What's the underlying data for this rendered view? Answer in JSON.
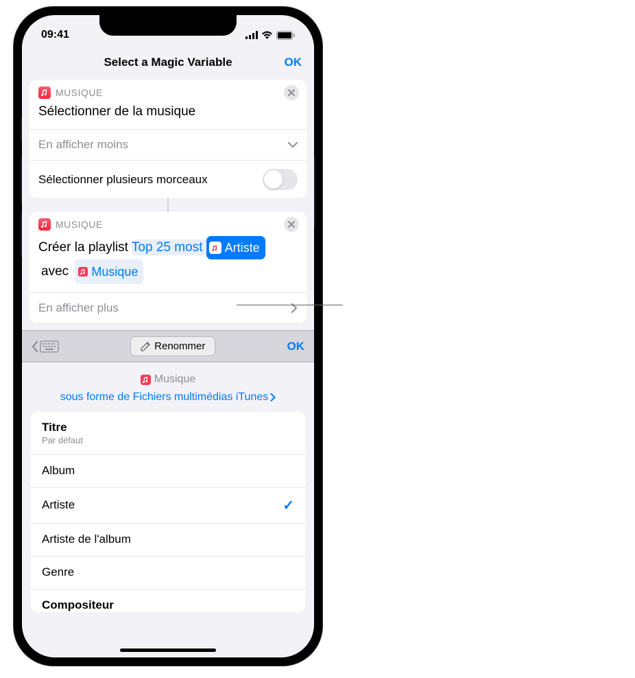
{
  "statusbar": {
    "time": "09:41"
  },
  "nav": {
    "title": "Select a Magic Variable",
    "ok": "OK"
  },
  "card1": {
    "app": "MUSIQUE",
    "title": "Sélectionner de la musique",
    "showLess": "En afficher moins",
    "multiSelect": "Sélectionner plusieurs morceaux"
  },
  "card2": {
    "app": "MUSIQUE",
    "actionPrefix": "Créer la playlist",
    "playlistName": "Top 25 most",
    "chipLabel": "Artiste",
    "withWord": "avec",
    "varLabel": "Musique",
    "showMore": "En afficher plus"
  },
  "toolbar": {
    "rename": "Renommer",
    "ok": "OK"
  },
  "varInfo": {
    "name": "Musique",
    "type": "sous forme de Fichiers multimédias iTunes"
  },
  "options": [
    {
      "label": "Titre",
      "sub": "Par défaut",
      "selected": false
    },
    {
      "label": "Album",
      "selected": false
    },
    {
      "label": "Artiste",
      "selected": true
    },
    {
      "label": "Artiste de l'album",
      "selected": false
    },
    {
      "label": "Genre",
      "selected": false
    },
    {
      "label": "Compositeur",
      "selected": false
    }
  ]
}
